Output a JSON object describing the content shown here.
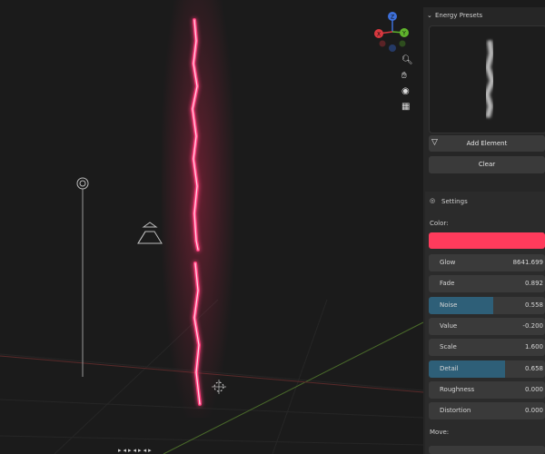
{
  "panel": {
    "presets": {
      "title": "Energy Presets",
      "add_label": "Add Element",
      "clear_label": "Clear"
    },
    "settings": {
      "title": "Settings",
      "color_label": "Color:",
      "color_value": "#ff3b5c",
      "fields": [
        {
          "label": "Glow",
          "value": "8641.699",
          "fill": 0
        },
        {
          "label": "Fade",
          "value": "0.892",
          "fill": 0
        },
        {
          "label": "Noise",
          "value": "0.558",
          "fill": 0.558
        },
        {
          "label": "Value",
          "value": "-0.200",
          "fill": 0
        },
        {
          "label": "Scale",
          "value": "1.600",
          "fill": 0
        },
        {
          "label": "Detail",
          "value": "0.658",
          "fill": 0.658
        },
        {
          "label": "Roughness",
          "value": "0.000",
          "fill": 0
        },
        {
          "label": "Distortion",
          "value": "0.000",
          "fill": 0
        }
      ],
      "move_label": "Move:"
    }
  },
  "gizmo": {
    "x_label": "X",
    "y_label": "Y",
    "z_label": "Z"
  },
  "colors": {
    "beam": "#ff3b7a",
    "x_axis": "#d8383f",
    "y_axis": "#5fb32c",
    "z_axis": "#3d6fd9"
  }
}
